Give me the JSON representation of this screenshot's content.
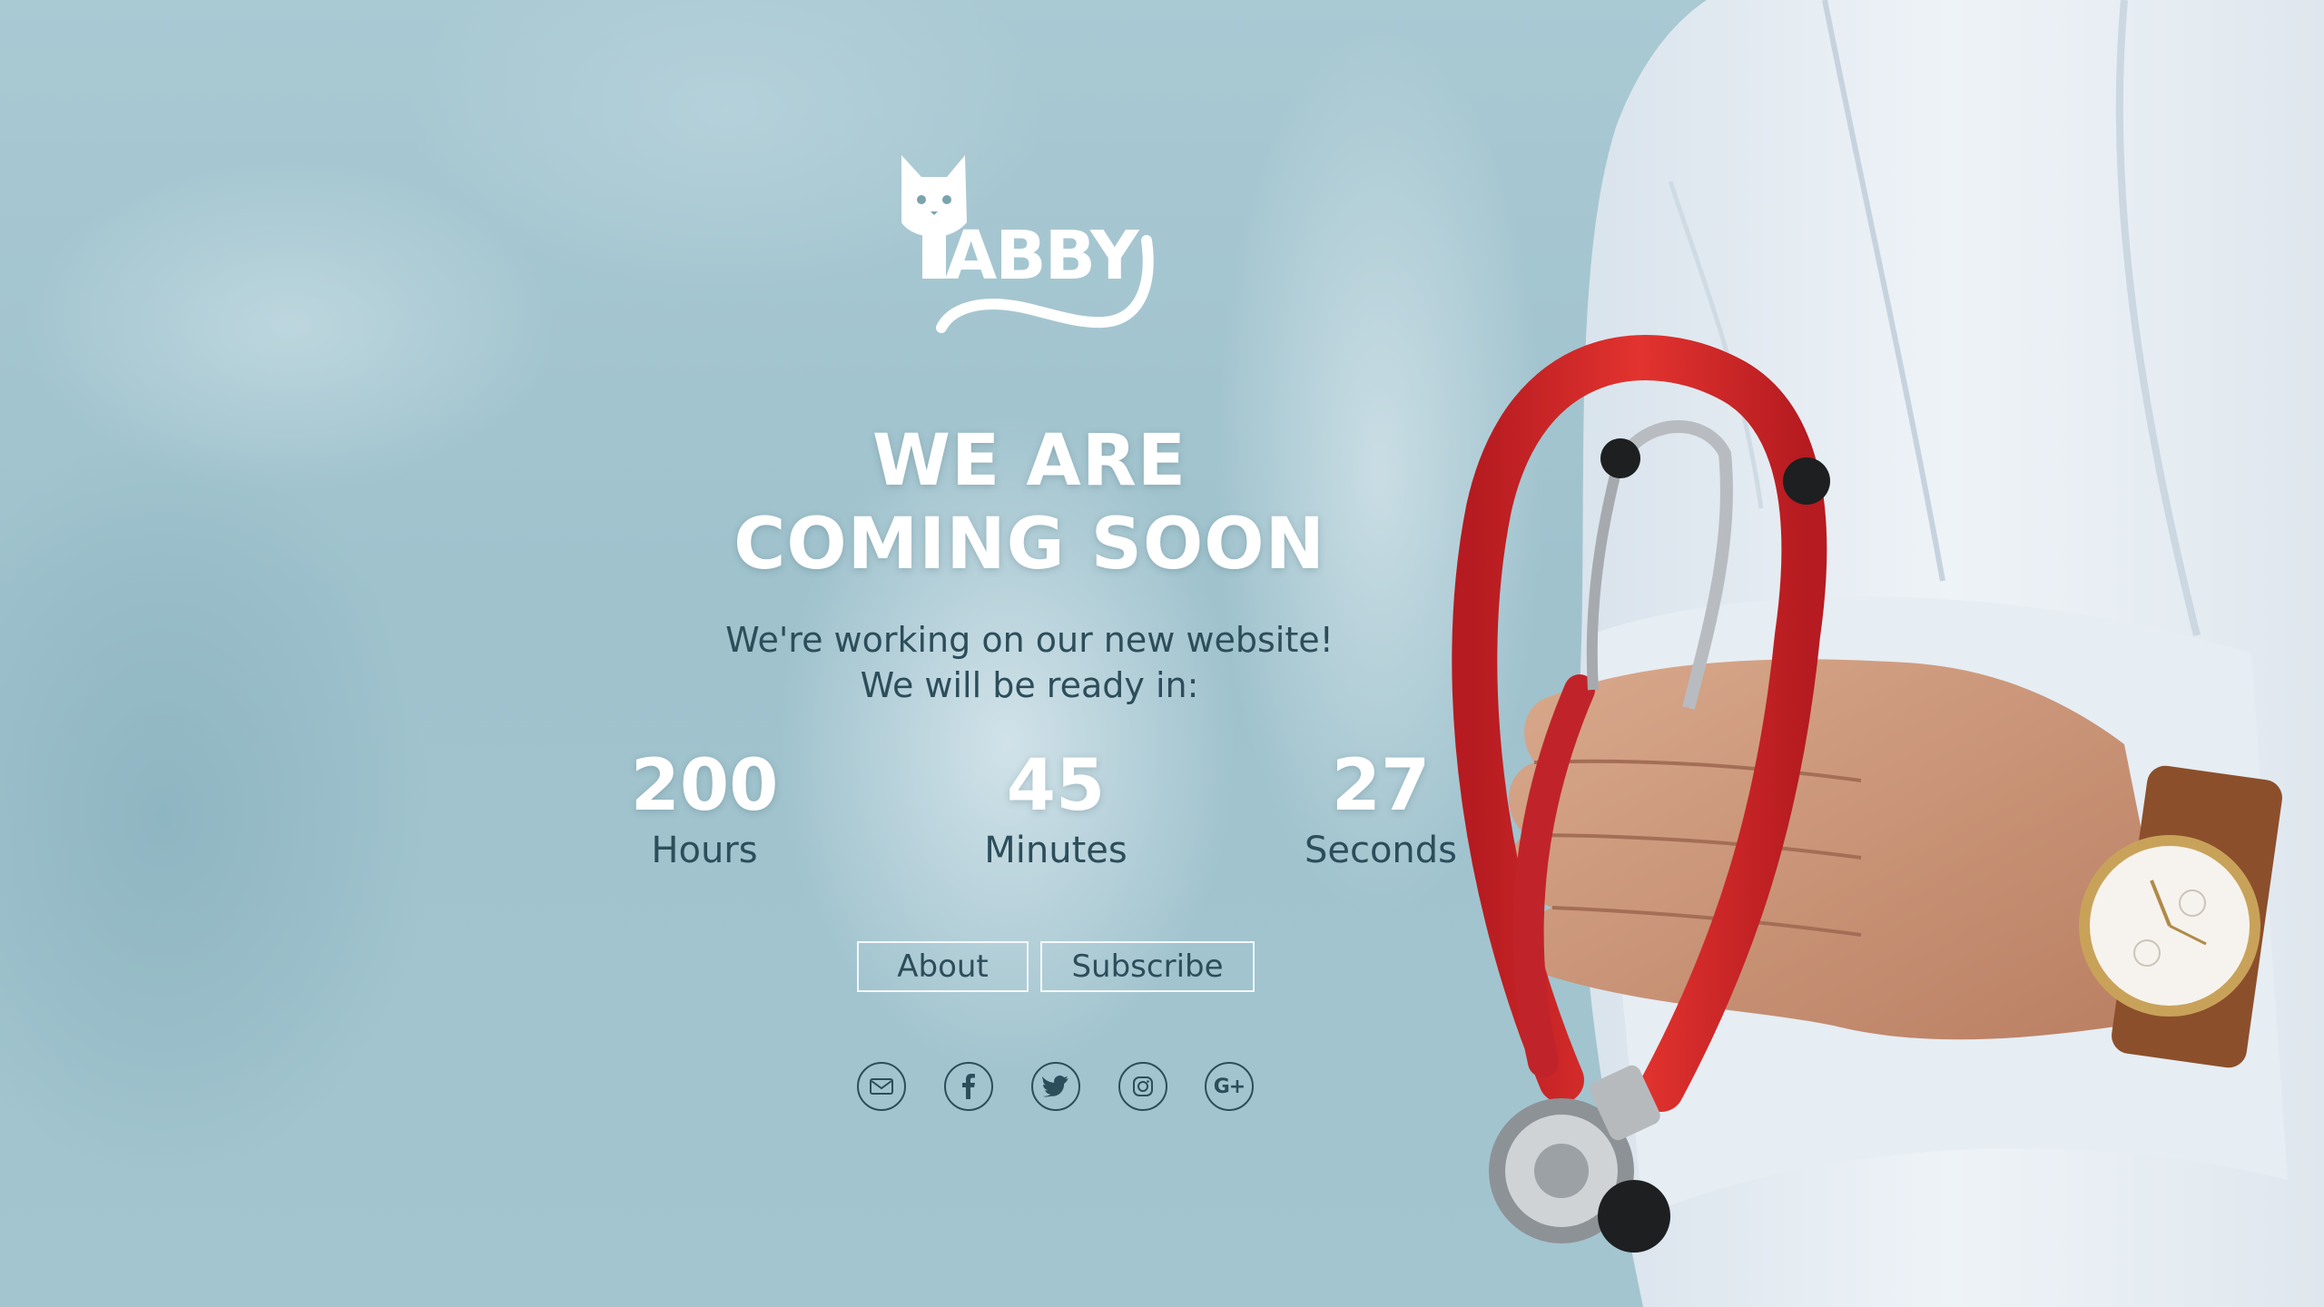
{
  "brand": {
    "logo_text": "TABBY"
  },
  "headline": {
    "line1": "WE ARE",
    "line2": "COMING SOON"
  },
  "subtext": {
    "line1": "We're working on our new website!",
    "line2": "We will be ready in:"
  },
  "countdown": {
    "hours": {
      "value": "200",
      "label": "Hours"
    },
    "minutes": {
      "value": "45",
      "label": "Minutes"
    },
    "seconds": {
      "value": "27",
      "label": "Seconds"
    }
  },
  "buttons": {
    "about": "About",
    "subscribe": "Subscribe"
  },
  "social": [
    {
      "icon": "mail-icon"
    },
    {
      "icon": "facebook-icon"
    },
    {
      "icon": "twitter-icon"
    },
    {
      "icon": "instagram-icon"
    },
    {
      "icon": "google-plus-icon",
      "text": "G+"
    }
  ],
  "colors": {
    "text_dark": "#2c4d5a",
    "text_light": "#ffffff",
    "background": "#a7c8d2",
    "stethoscope_red": "#d8262a",
    "coat_white": "#e8eef4"
  }
}
